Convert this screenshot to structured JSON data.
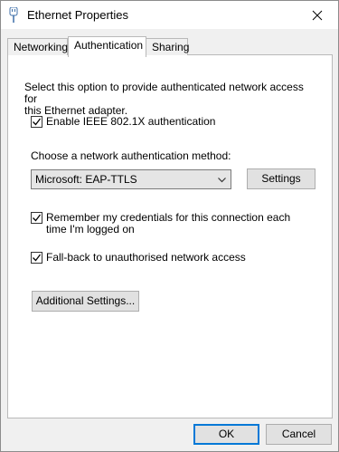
{
  "window": {
    "title": "Ethernet Properties",
    "icon": "network-adapter-icon"
  },
  "tabs": [
    {
      "label": "Networking",
      "selected": false
    },
    {
      "label": "Authentication",
      "selected": true
    },
    {
      "label": "Sharing",
      "selected": false
    }
  ],
  "auth": {
    "description_line1": "Select this option to provide authenticated network access for",
    "description_line2": "this Ethernet adapter.",
    "enable_8021x": {
      "label": "Enable IEEE 802.1X authentication",
      "checked": true
    },
    "method_label": "Choose a network authentication method:",
    "method_selected": "Microsoft: EAP-TTLS",
    "settings_button": "Settings",
    "remember_credentials": {
      "line1": "Remember my credentials for this connection each",
      "line2": "time I'm logged on",
      "checked": true
    },
    "fallback": {
      "label": "Fall-back to unauthorised network access",
      "checked": true
    },
    "additional_settings_button": "Additional Settings..."
  },
  "footer": {
    "ok_label": "OK",
    "cancel_label": "Cancel"
  }
}
